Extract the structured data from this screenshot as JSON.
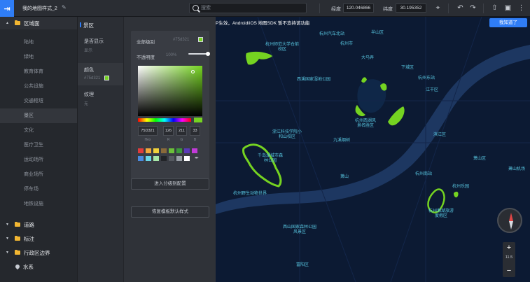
{
  "topbar": {
    "logo_glyph": "⇥",
    "doc_title": "我的地图样式_2",
    "edit_glyph": "✎",
    "search_placeholder": "搜索",
    "longitude_label": "经度",
    "longitude_value": "120.046866",
    "latitude_label": "纬度",
    "latitude_value": "30.195352",
    "icons": {
      "locate": "⌖",
      "undo": "↶",
      "redo": "↷",
      "export": "⇧",
      "save": "▣",
      "more": "⋮"
    }
  },
  "sidebar": {
    "categories": [
      {
        "label": "区域面",
        "caret": "▲",
        "expanded": true
      },
      {
        "label": "道路",
        "caret": "▼"
      },
      {
        "label": "标注",
        "caret": "▼"
      },
      {
        "label": "行政区边界",
        "caret": "▼"
      },
      {
        "label": "水系",
        "caret": ""
      }
    ],
    "sub_items": [
      "陆地",
      "绿地",
      "教育体育",
      "公共设施",
      "交通枢纽",
      "景区",
      "文化",
      "医疗卫生",
      "运动场所",
      "商业场所",
      "停车场",
      "地铁设施"
    ],
    "selected_sub_item": "景区"
  },
  "props": {
    "title": "景区",
    "visibility": {
      "label": "是否显示",
      "value": "显示"
    },
    "color": {
      "label": "颜色",
      "value": "#75d321"
    },
    "texture": {
      "label": "纹理",
      "value": "无"
    }
  },
  "settings": {
    "fill_label": "全部级别",
    "fill_hex": "#75d321",
    "opacity_label": "不透明度",
    "opacity_value": "100%",
    "opacity_fraction": 1.0,
    "hex_input": "75D321",
    "r": "126",
    "g": "211",
    "b": "33",
    "cap_hex": "Hex",
    "cap_r": "R",
    "cap_g": "G",
    "cap_b": "B",
    "swatches": [
      "#e03c3c",
      "#f2a93b",
      "#f2d23b",
      "#8a6a3a",
      "#6bbf3a",
      "#3a9a3a",
      "#5a3ab8",
      "#c23ad8",
      "#4a8ae0",
      "#6ad8e8",
      "#a8e8a8",
      "#222428",
      "#555960",
      "#9aa0a8",
      "#ffffff"
    ],
    "eyedropper_glyph": "✒",
    "btn_level": "进入分级别配置",
    "btn_reset": "恢复模板默认样式"
  },
  "map": {
    "notice": "P生效，Android/iOS 地图SDK 暂不支持该功能",
    "ok_label": "我知道了",
    "zoom_level": "11.5",
    "zoom_in": "+",
    "zoom_out": "−",
    "highlight_color": "#75d321",
    "water_color": "#1d3761",
    "land_color": "#0c1a33",
    "labels": [
      {
        "text": "杭州汽车北站"
      },
      {
        "text": "半山区"
      },
      {
        "text": "杭州市"
      },
      {
        "text": "杭州师范大学仓前校区"
      },
      {
        "text": "大马弄"
      },
      {
        "text": "下城区"
      },
      {
        "text": "西溪国家湿地公园"
      },
      {
        "text": "杭州东站"
      },
      {
        "text": "江干区"
      },
      {
        "text": "杭州西湖风景名胜区"
      },
      {
        "text": "浙江科技学院小和山校区"
      },
      {
        "text": "九溪烟树"
      },
      {
        "text": "千岛湖城市森林公园"
      },
      {
        "text": "萧山机场"
      },
      {
        "text": "滨江区"
      },
      {
        "text": "萧山区"
      },
      {
        "text": "杭州南站"
      },
      {
        "text": "杭州野生动物世界"
      },
      {
        "text": "杭州乐园"
      },
      {
        "text": "杭州湘湖旅游度假区"
      },
      {
        "text": "西山国家森林公园风景区"
      },
      {
        "text": "富阳区"
      },
      {
        "text": "萧山"
      }
    ]
  }
}
